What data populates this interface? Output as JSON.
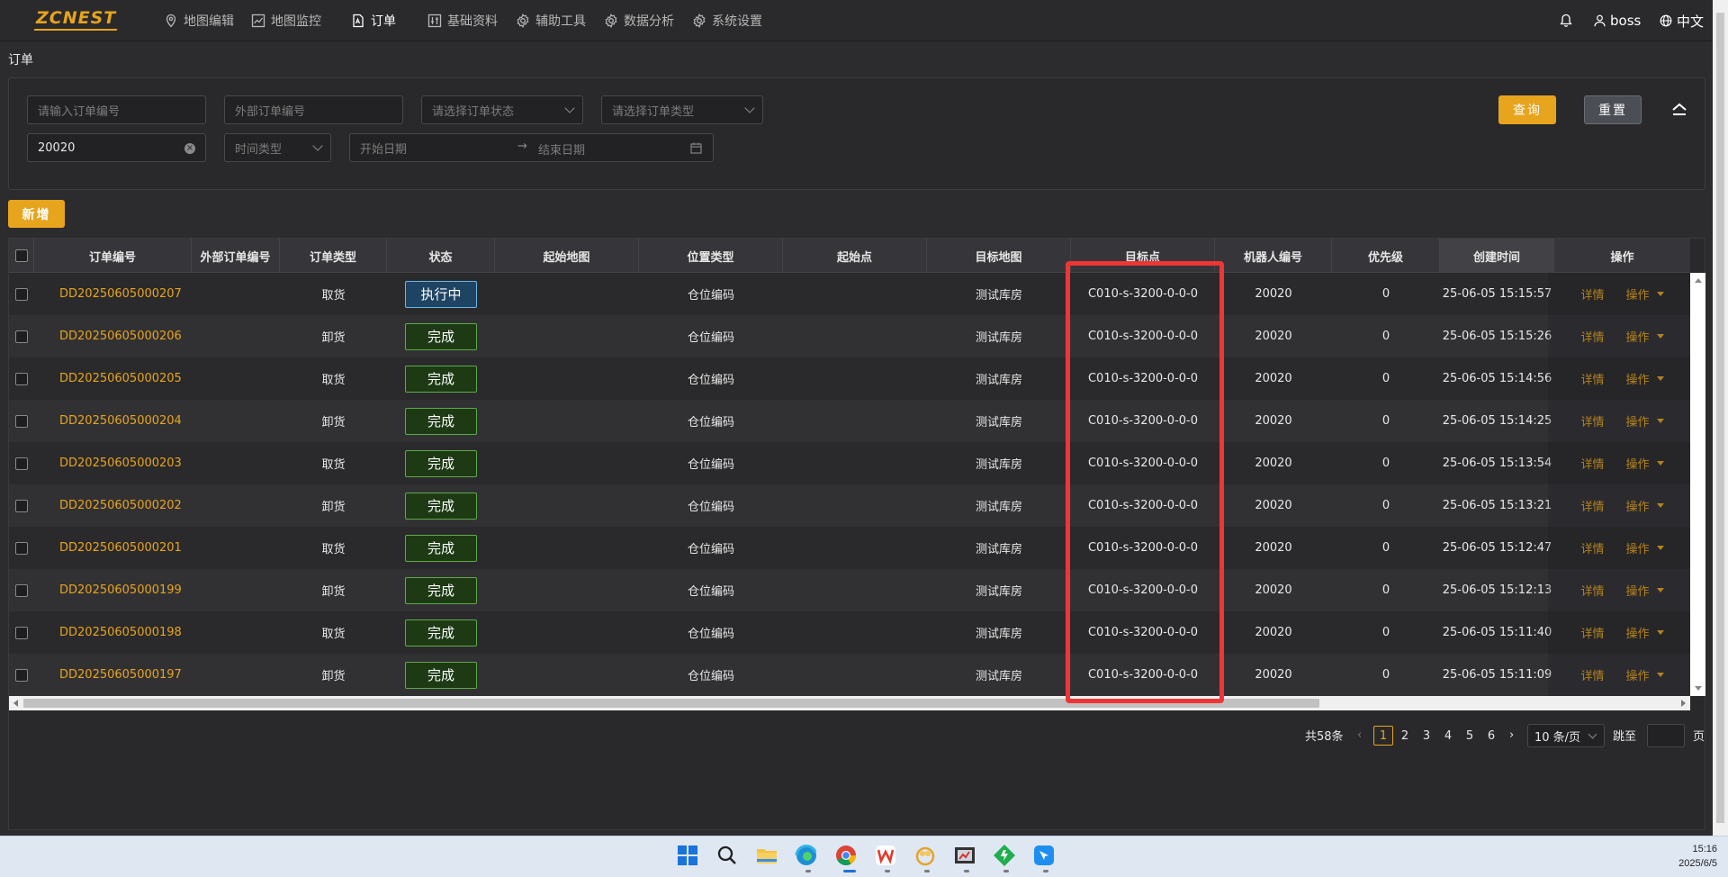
{
  "app": {
    "logo": "ZCNEST"
  },
  "nav": {
    "items": [
      {
        "label": "地图编辑",
        "icon": "map-pin-icon"
      },
      {
        "label": "地图监控",
        "icon": "chart-line-icon"
      },
      {
        "label": "订单",
        "icon": "document-icon",
        "active": true
      },
      {
        "label": "基础资料",
        "icon": "sliders-icon"
      },
      {
        "label": "辅助工具",
        "icon": "gear-icon"
      },
      {
        "label": "数据分析",
        "icon": "gear-icon"
      },
      {
        "label": "系统设置",
        "icon": "gear-icon"
      }
    ],
    "user": "boss",
    "language": "中文"
  },
  "page": {
    "title": "订单"
  },
  "filters": {
    "order_no_placeholder": "请输入订单编号",
    "external_no_placeholder": "外部订单编号",
    "status_placeholder": "请选择订单状态",
    "type_placeholder": "请选择订单类型",
    "robot_value": "20020",
    "time_type_placeholder": "时间类型",
    "start_date_placeholder": "开始日期",
    "end_date_placeholder": "结束日期",
    "query_label": "查询",
    "reset_label": "重置"
  },
  "toolbar": {
    "add_label": "新增"
  },
  "table": {
    "headers": [
      "订单编号",
      "外部订单编号",
      "订单类型",
      "状态",
      "起始地图",
      "位置类型",
      "起始点",
      "目标地图",
      "目标点",
      "机器人编号",
      "优先级",
      "创建时间",
      "操作"
    ],
    "rows": [
      {
        "order_no": "DD20250605000207",
        "ext_no": "",
        "type": "取货",
        "status": "执行中",
        "status_kind": "running",
        "start_map": "",
        "loc_type": "仓位编码",
        "start_point": "",
        "target_map": "测试库房",
        "target_point": "C010-s-3200-0-0-0",
        "robot": "20020",
        "priority": "0",
        "created": "25-06-05 15:15:57",
        "detail": "详情",
        "op": "操作"
      },
      {
        "order_no": "DD20250605000206",
        "ext_no": "",
        "type": "卸货",
        "status": "完成",
        "status_kind": "done",
        "start_map": "",
        "loc_type": "仓位编码",
        "start_point": "",
        "target_map": "测试库房",
        "target_point": "C010-s-3200-0-0-0",
        "robot": "20020",
        "priority": "0",
        "created": "25-06-05 15:15:26",
        "detail": "详情",
        "op": "操作"
      },
      {
        "order_no": "DD20250605000205",
        "ext_no": "",
        "type": "取货",
        "status": "完成",
        "status_kind": "done",
        "start_map": "",
        "loc_type": "仓位编码",
        "start_point": "",
        "target_map": "测试库房",
        "target_point": "C010-s-3200-0-0-0",
        "robot": "20020",
        "priority": "0",
        "created": "25-06-05 15:14:56",
        "detail": "详情",
        "op": "操作"
      },
      {
        "order_no": "DD20250605000204",
        "ext_no": "",
        "type": "卸货",
        "status": "完成",
        "status_kind": "done",
        "start_map": "",
        "loc_type": "仓位编码",
        "start_point": "",
        "target_map": "测试库房",
        "target_point": "C010-s-3200-0-0-0",
        "robot": "20020",
        "priority": "0",
        "created": "25-06-05 15:14:25",
        "detail": "详情",
        "op": "操作"
      },
      {
        "order_no": "DD20250605000203",
        "ext_no": "",
        "type": "取货",
        "status": "完成",
        "status_kind": "done",
        "start_map": "",
        "loc_type": "仓位编码",
        "start_point": "",
        "target_map": "测试库房",
        "target_point": "C010-s-3200-0-0-0",
        "robot": "20020",
        "priority": "0",
        "created": "25-06-05 15:13:54",
        "detail": "详情",
        "op": "操作"
      },
      {
        "order_no": "DD20250605000202",
        "ext_no": "",
        "type": "卸货",
        "status": "完成",
        "status_kind": "done",
        "start_map": "",
        "loc_type": "仓位编码",
        "start_point": "",
        "target_map": "测试库房",
        "target_point": "C010-s-3200-0-0-0",
        "robot": "20020",
        "priority": "0",
        "created": "25-06-05 15:13:21",
        "detail": "详情",
        "op": "操作"
      },
      {
        "order_no": "DD20250605000201",
        "ext_no": "",
        "type": "取货",
        "status": "完成",
        "status_kind": "done",
        "start_map": "",
        "loc_type": "仓位编码",
        "start_point": "",
        "target_map": "测试库房",
        "target_point": "C010-s-3200-0-0-0",
        "robot": "20020",
        "priority": "0",
        "created": "25-06-05 15:12:47",
        "detail": "详情",
        "op": "操作"
      },
      {
        "order_no": "DD20250605000199",
        "ext_no": "",
        "type": "卸货",
        "status": "完成",
        "status_kind": "done",
        "start_map": "",
        "loc_type": "仓位编码",
        "start_point": "",
        "target_map": "测试库房",
        "target_point": "C010-s-3200-0-0-0",
        "robot": "20020",
        "priority": "0",
        "created": "25-06-05 15:12:13",
        "detail": "详情",
        "op": "操作"
      },
      {
        "order_no": "DD20250605000198",
        "ext_no": "",
        "type": "取货",
        "status": "完成",
        "status_kind": "done",
        "start_map": "",
        "loc_type": "仓位编码",
        "start_point": "",
        "target_map": "测试库房",
        "target_point": "C010-s-3200-0-0-0",
        "robot": "20020",
        "priority": "0",
        "created": "25-06-05 15:11:40",
        "detail": "详情",
        "op": "操作"
      },
      {
        "order_no": "DD20250605000197",
        "ext_no": "",
        "type": "卸货",
        "status": "完成",
        "status_kind": "done",
        "start_map": "",
        "loc_type": "仓位编码",
        "start_point": "",
        "target_map": "测试库房",
        "target_point": "C010-s-3200-0-0-0",
        "robot": "20020",
        "priority": "0",
        "created": "25-06-05 15:11:09",
        "detail": "详情",
        "op": "操作"
      }
    ]
  },
  "pagination": {
    "total": "共58条",
    "pages": [
      "1",
      "2",
      "3",
      "4",
      "5",
      "6"
    ],
    "current": "1",
    "page_size": "10 条/页",
    "jump_label": "跳至",
    "page_suffix": "页"
  },
  "taskbar": {
    "icons": [
      "windows-start-icon",
      "search-icon",
      "file-explorer-icon",
      "edge-browser-icon",
      "chrome-browser-icon",
      "wps-office-icon",
      "app-circle-icon",
      "screenshot-tool-icon",
      "green-app-icon",
      "feishu-icon"
    ],
    "time": "15:16",
    "date": "2025/6/5"
  },
  "colors": {
    "accent": "#e7a41d",
    "highlight": "#ef3535",
    "status_running": "#1f4463",
    "status_done": "#1d3a14"
  }
}
